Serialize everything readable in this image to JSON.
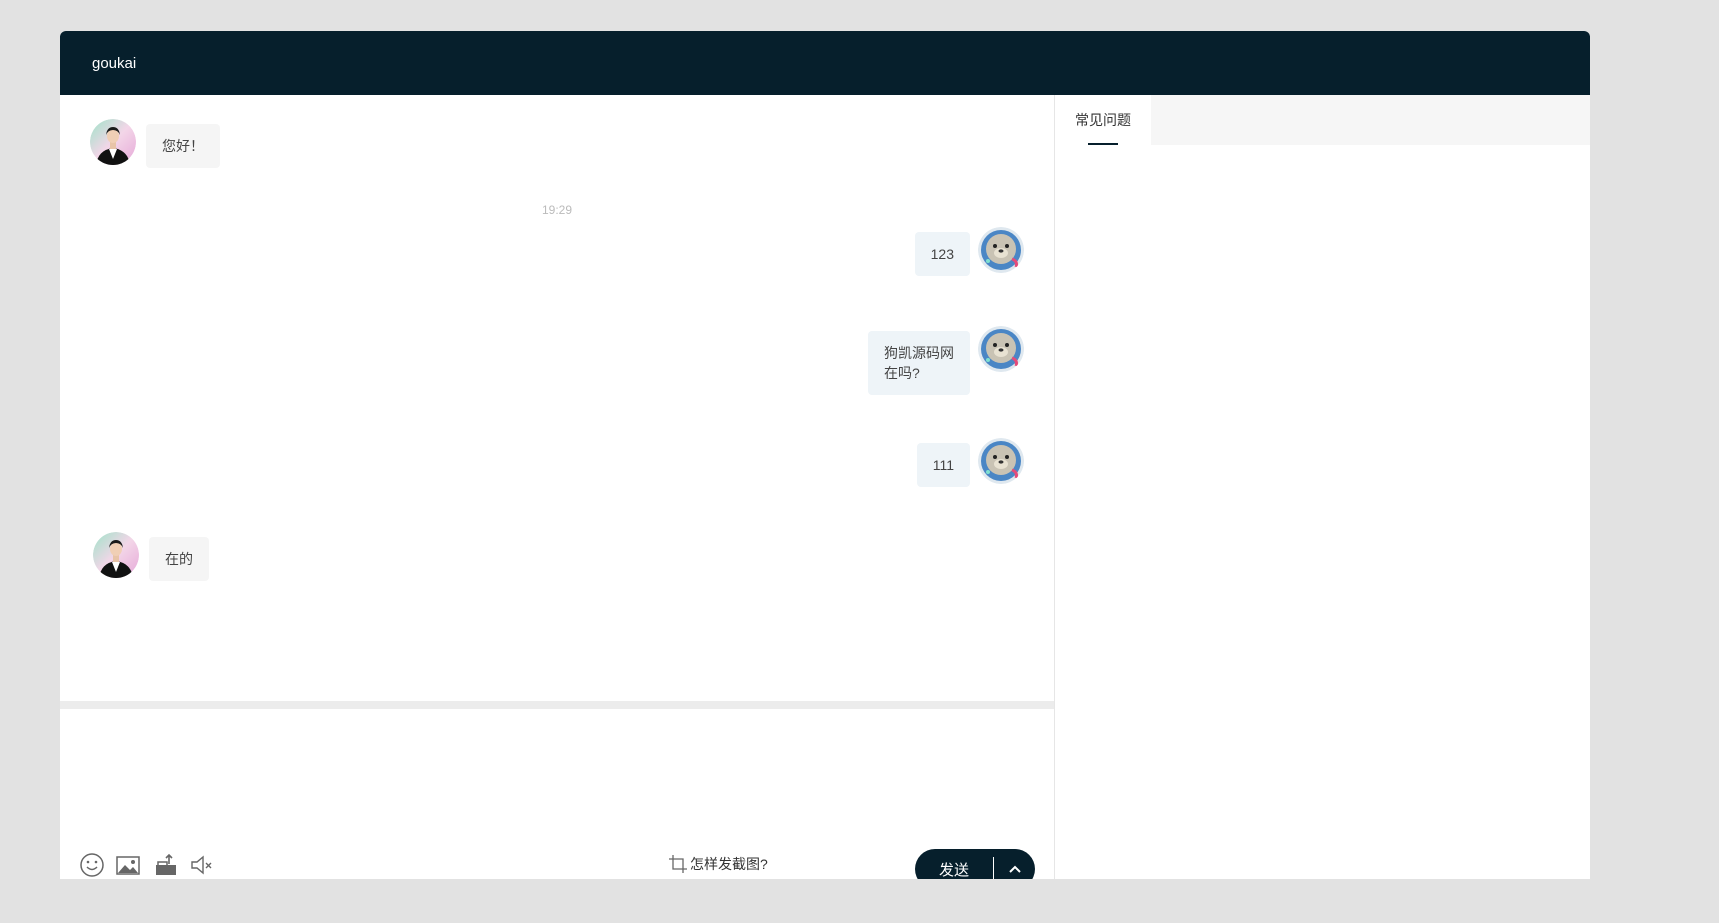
{
  "header": {
    "title": "goukai"
  },
  "messages": [
    {
      "side": "left",
      "text": "您好！",
      "avatar_icon": "agent-avatar-icon"
    },
    {
      "side": "center",
      "timestamp": "19:29"
    },
    {
      "side": "right",
      "text": "123",
      "avatar_icon": "user-seal-avatar-icon"
    },
    {
      "side": "right",
      "lines": [
        "狗凯源码网",
        "在吗?"
      ],
      "avatar_icon": "user-seal-avatar-icon"
    },
    {
      "side": "right",
      "text": "111",
      "avatar_icon": "user-seal-avatar-icon"
    },
    {
      "side": "left",
      "text": "在的",
      "avatar_icon": "agent-avatar-icon"
    }
  ],
  "composer": {
    "input_value": "",
    "toolbar_icons": [
      "emoji-icon",
      "image-icon",
      "file-upload-icon",
      "sound-off-icon"
    ],
    "screenshot_help": "怎样发截图?",
    "send_label": "发送"
  },
  "side_panel": {
    "tabs": [
      {
        "label": "常见问题",
        "active": true
      }
    ]
  },
  "colors": {
    "header_bg": "#061f2c",
    "page_bg": "#e2e2e2",
    "agent_bubble": "#f5f5f5",
    "user_bubble": "#eef4f8"
  }
}
